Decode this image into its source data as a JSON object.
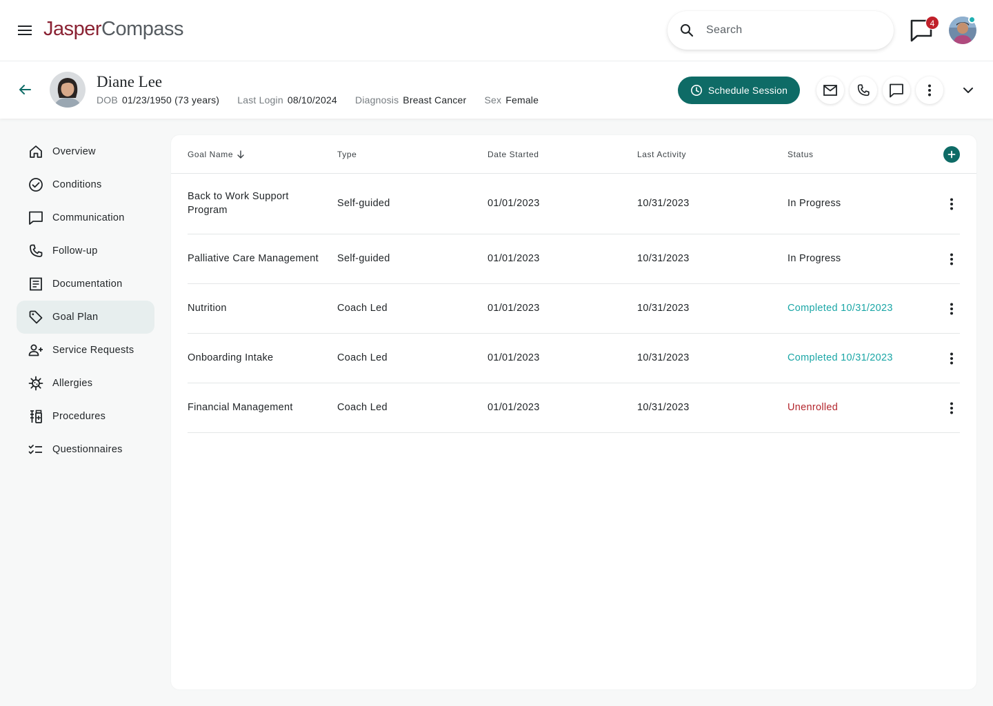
{
  "app": {
    "logo_part1": "Jasper",
    "logo_part2": "Compass",
    "search_placeholder": "Search",
    "notification_count": "4"
  },
  "patient": {
    "name": "Diane Lee",
    "dob_label": "DOB",
    "dob_value": "01/23/1950 (73 years)",
    "last_login_label": "Last Login",
    "last_login_value": "08/10/2024",
    "diagnosis_label": "Diagnosis",
    "diagnosis_value": "Breast Cancer",
    "sex_label": "Sex",
    "sex_value": "Female",
    "schedule_label": "Schedule Session"
  },
  "sidebar": {
    "items": [
      {
        "label": "Overview",
        "icon": "home-icon"
      },
      {
        "label": "Conditions",
        "icon": "check-circle-icon"
      },
      {
        "label": "Communication",
        "icon": "chat-icon"
      },
      {
        "label": "Follow-up",
        "icon": "phone-icon"
      },
      {
        "label": "Documentation",
        "icon": "document-icon"
      },
      {
        "label": "Goal Plan",
        "icon": "tag-icon",
        "active": true
      },
      {
        "label": "Service Requests",
        "icon": "person-add-icon"
      },
      {
        "label": "Allergies",
        "icon": "virus-icon"
      },
      {
        "label": "Procedures",
        "icon": "medication-icon"
      },
      {
        "label": "Questionnaires",
        "icon": "checklist-icon"
      }
    ]
  },
  "table": {
    "headers": {
      "goal_name": "Goal Name",
      "type": "Type",
      "date_started": "Date Started",
      "last_activity": "Last Activity",
      "status": "Status"
    },
    "rows": [
      {
        "goal": "Back to Work Support Program",
        "type": "Self-guided",
        "date_started": "01/01/2023",
        "last_activity": "10/31/2023",
        "status": "In Progress",
        "status_kind": "progress"
      },
      {
        "goal": "Palliative Care Management",
        "type": "Self-guided",
        "date_started": "01/01/2023",
        "last_activity": "10/31/2023",
        "status": "In Progress",
        "status_kind": "progress"
      },
      {
        "goal": "Nutrition",
        "type": "Coach Led",
        "date_started": "01/01/2023",
        "last_activity": "10/31/2023",
        "status": "Completed 10/31/2023",
        "status_kind": "completed"
      },
      {
        "goal": "Onboarding Intake",
        "type": "Coach Led",
        "date_started": "01/01/2023",
        "last_activity": "10/31/2023",
        "status": "Completed 10/31/2023",
        "status_kind": "completed"
      },
      {
        "goal": "Financial Management",
        "type": "Coach Led",
        "date_started": "01/01/2023",
        "last_activity": "10/31/2023",
        "status": "Unenrolled",
        "status_kind": "unenrolled"
      }
    ]
  },
  "colors": {
    "brand_primary": "#0e6b66",
    "logo_red": "#8a2233",
    "status_completed": "#1aa6a6",
    "status_unenrolled": "#b3262d",
    "badge": "#c0202a"
  }
}
